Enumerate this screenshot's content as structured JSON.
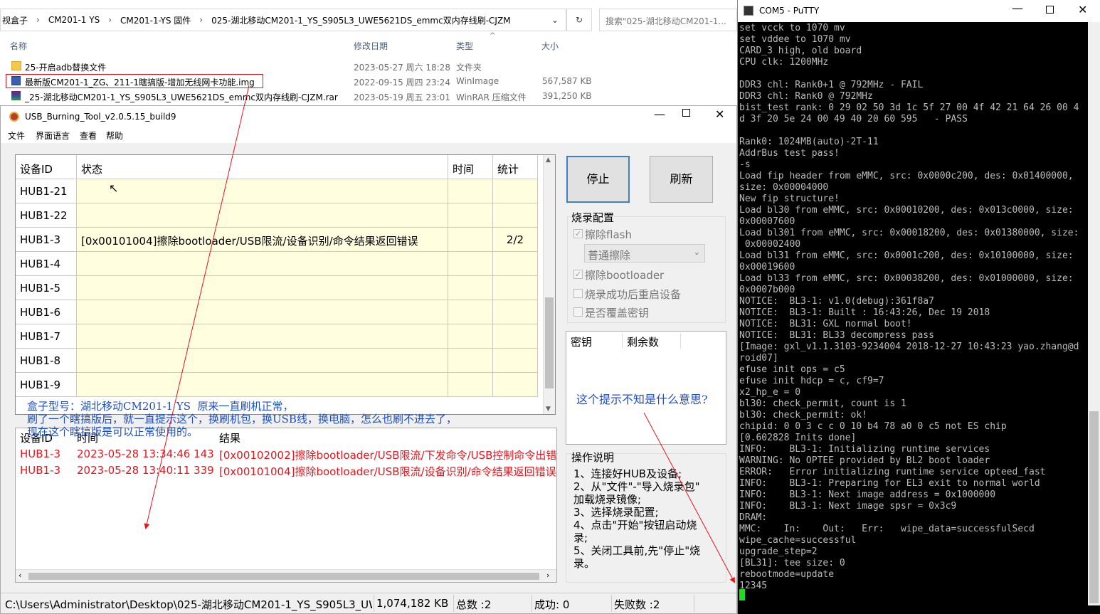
{
  "explorer": {
    "breadcrumb": [
      "视盒子",
      "CM201-1 YS",
      "CM201-1-YS 固件",
      "025-湖北移动CM201-1_YS_S905L3_UWE5621DS_emmc双内存线刷-CJZM"
    ],
    "search_placeholder": "搜索\"025-湖北移动CM201-1...",
    "columns": [
      "名称",
      "修改日期",
      "类型",
      "大小"
    ],
    "files": [
      {
        "name": "25-开启adb替换文件",
        "date": "2023-05-27 周六 18:28",
        "type": "文件夹",
        "size": "",
        "icon": "folder-icon"
      },
      {
        "name": "最新版CM201-1_ZG、211-1瞎搞版-增加无线网卡功能.img",
        "date": "2022-09-15 周四 23:24",
        "type": "WinImage",
        "size": "567,587 KB",
        "icon": "disk-image-icon"
      },
      {
        "name": "_25-湖北移动CM201-1_YS_S905L3_UWE5621DS_emmc双内存线刷-CJZM.rar",
        "date": "2023-05-19 周五 23:01",
        "type": "WinRAR 压缩文件",
        "size": "391,250 KB",
        "icon": "rar-archive-icon"
      }
    ]
  },
  "tool": {
    "title": "USB_Burning_Tool_v2.0.5.15_build9",
    "menu": [
      "文件",
      "界面语言",
      "查看",
      "帮助"
    ],
    "grid_headers": [
      "设备ID",
      "状态",
      "时间",
      "统计"
    ],
    "rows": [
      {
        "id": "HUB1-21",
        "status": "",
        "time": "",
        "count": ""
      },
      {
        "id": "HUB1-22",
        "status": "",
        "time": "",
        "count": ""
      },
      {
        "id": "HUB1-3",
        "status": "[0x00101004]擦除bootloader/USB限流/设备识别/命令结果返回错误",
        "time": "",
        "count": "2/2"
      },
      {
        "id": "HUB1-4",
        "status": "",
        "time": "",
        "count": ""
      },
      {
        "id": "HUB1-5",
        "status": "",
        "time": "",
        "count": ""
      },
      {
        "id": "HUB1-6",
        "status": "",
        "time": "",
        "count": ""
      },
      {
        "id": "HUB1-7",
        "status": "",
        "time": "",
        "count": ""
      },
      {
        "id": "HUB1-8",
        "status": "",
        "time": "",
        "count": ""
      },
      {
        "id": "HUB1-9",
        "status": "",
        "time": "",
        "count": ""
      }
    ],
    "stop_label": "停止",
    "refresh_label": "刷新",
    "config_title": "烧录配置",
    "erase_flash": "擦除flash",
    "erase_mode": "普通擦除",
    "erase_bootloader": "擦除bootloader",
    "reboot_after": "烧录成功后重启设备",
    "overwrite_key": "是否覆盖密钥",
    "keys_headers": [
      "密钥",
      "剩余数"
    ],
    "instructions_title": "操作说明",
    "instructions": "1、连接好HUB及设备;\n2、从\"文件\"-\"导入烧录包\"\n加载烧录镜像;\n3、选择烧录配置;\n4、点击\"开始\"按钮启动烧\n录;\n5、关闭工具前,先\"停止\"烧\n录。",
    "log_headers": [
      "设备ID",
      "时间",
      "结果"
    ],
    "logs": [
      {
        "id": "HUB1-3",
        "time": "2023-05-28 13:34:46 143",
        "result": "[0x00102002]擦除bootloader/USB限流/下发命令/USB控制命令出错"
      },
      {
        "id": "HUB1-3",
        "time": "2023-05-28 13:40:11 339",
        "result": "[0x00101004]擦除bootloader/USB限流/设备识别/命令结果返回错误"
      }
    ],
    "note": "盒子型号：湖北移动CM201-1 YS  原来一直刷机正常，\n刷了一个瞎搞版后，就一直提示这个，换刷机包，换USB线，换电脑，怎么也刷不进去了，\n现在这个瞎搞版是可以正常使用的。",
    "note2": "这个提示不知是什么意思?",
    "status": {
      "path": "C:\\Users\\Administrator\\Desktop\\025-湖北移动CM201-1_YS_S905L3_UW",
      "size": "1,074,182 KB",
      "total": "总数 :2",
      "success": "成功:  0",
      "fail": "失败数 :2"
    }
  },
  "putty": {
    "title": "COM5 - PuTTY",
    "lines": "set vcck to 1070 mv\nset vddee to 1070 mv\nCARD_3 high, old board\nCPU clk: 1200MHz\n\nDDR3 chl: Rank0+1 @ 792MHz - FAIL\nDDR3 chl: Rank0 @ 792MHz\nbist_test rank: 0 29 02 50 3d 1c 5f 27 00 4f 42 21 64 26 00 4\nd 3f 20 5e 24 00 49 40 20 60 595   - PASS\n\nRank0: 1024MB(auto)-2T-11\nAddrBus test pass!\n-s\nLoad fip header from eMMC, src: 0x0000c200, des: 0x01400000,\nsize: 0x00004000\nNew fip structure!\nLoad bl30 from eMMC, src: 0x00010200, des: 0x013c0000, size:\n0x00007600\nLoad bl301 from eMMC, src: 0x00018200, des: 0x01380000, size:\n 0x00002400\nLoad bl31 from eMMC, src: 0x0001c200, des: 0x10100000, size:\n0x00019600\nLoad bl33 from eMMC, src: 0x00038200, des: 0x01000000, size:\n0x0007b000\nNOTICE:  BL3-1: v1.0(debug):361f8a7\nNOTICE:  BL3-1: Built : 16:43:26, Dec 19 2018\nNOTICE:  BL31: GXL normal boot!\nNOTICE:  BL31: BL33 decompress pass\n[Image: gxl_v1.1.3103-9234004 2018-12-27 10:43:23 yao.zhang@d\nroid07]\nefuse init ops = c5\nefuse init hdcp = c, cf9=7\nx2_hp_e = 0\nbl30: check_permit, count is 1\nbl30: check_permit: ok!\nchipid: 0 0 3 c c 0 10 b4 78 a0 0 c5 not ES chip\n[0.602828 Inits done]\nINFO:    BL3-1: Initializing runtime services\nWARNING: No OPTEE provided by BL2 boot loader\nERROR:   Error initializing runtime service opteed_fast\nINFO:    BL3-1: Preparing for EL3 exit to normal world\nINFO:    BL3-1: Next image address = 0x1000000\nINFO:    BL3-1: Next image spsr = 0x3c9\nDRAM:\nMMC:    In:    Out:   Err:   wipe_data=successfulSecd\nwipe_cache=successful\nupgrade_step=2\n[BL31]: tee size: 0\nrebootmode=update\n12345"
  },
  "colors": {
    "error_red": "#e8141b",
    "note_blue": "#1d4ec8",
    "grid_yellow": "#ffffe0",
    "annotation_red": "#e8141b"
  }
}
